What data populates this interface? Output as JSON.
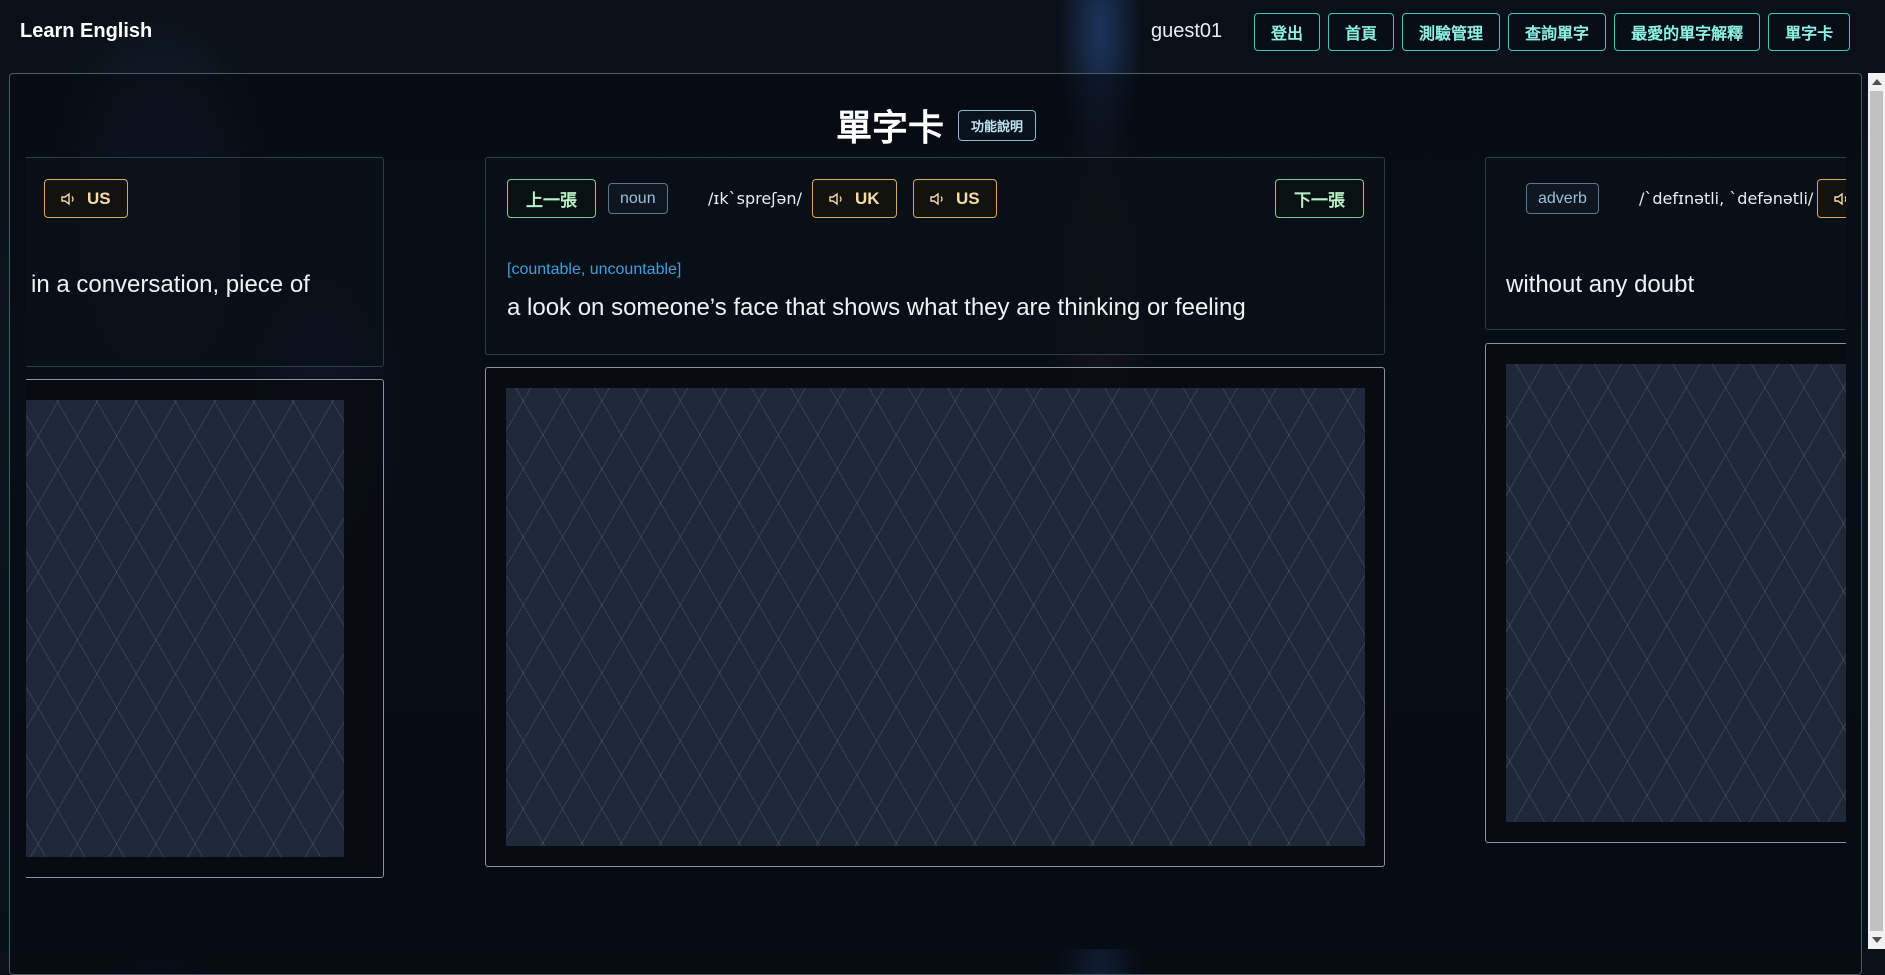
{
  "header": {
    "brand": "Learn English",
    "username": "guest01",
    "nav": [
      "登出",
      "首頁",
      "測驗管理",
      "查詢單字",
      "最愛的單字解釋",
      "單字卡"
    ]
  },
  "page": {
    "title": "單字卡",
    "help_label": "功能說明"
  },
  "left_card": {
    "us_label": "US",
    "definition": "in a conversation, piece of"
  },
  "center_card": {
    "prev_label": "上一張",
    "next_label": "下一張",
    "pos": "noun",
    "ipa": "/ɪk`spreʃən/",
    "uk_label": "UK",
    "us_label": "US",
    "grammar": "[countable, uncountable]",
    "definition": "a look on someone’s face that shows what they are thinking or feeling"
  },
  "right_card": {
    "pos": "adverb",
    "ipa": "/`defɪnətli, `defənətli/",
    "definition": "without any doubt"
  },
  "colors": {
    "nav_accent": "#3fc7c0",
    "audio_accent": "#d9a860",
    "nav_green": "#7fc8a0",
    "grammar_blue": "#3d9fe0"
  },
  "icons": [
    "speaker-icon"
  ]
}
